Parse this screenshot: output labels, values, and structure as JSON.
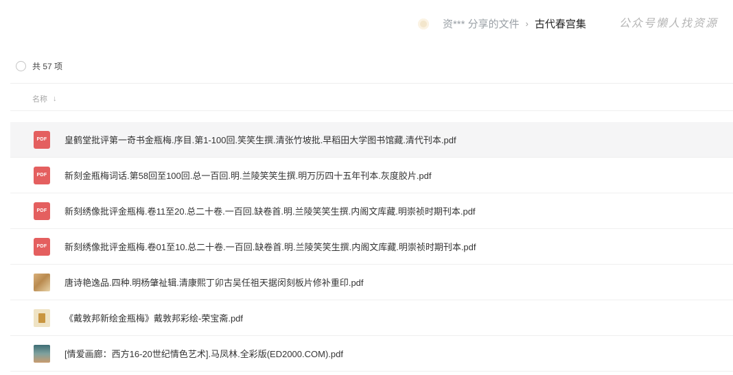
{
  "breadcrumb": {
    "owner": "资*** 分享的文件",
    "separator": "›",
    "current": "古代春宫集"
  },
  "watermark": "公众号懒人找资源",
  "summary": {
    "count_text": "共 57 项"
  },
  "sort_header": {
    "label": "名称",
    "arrow": "↓"
  },
  "files": [
    {
      "name": "皇鹤堂批评第一奇书金瓶梅.序目.第1-100回.笑笑生撰.清张竹坡批.早稻田大学图书馆藏.清代刊本.pdf",
      "icon": "pdf-file-icon",
      "icon_label": "PDF"
    },
    {
      "name": "新刻金瓶梅词话.第58回至100回.总一百回.明.兰陵笑笑生撰.明万历四十五年刊本.灰度胶片.pdf",
      "icon": "pdf-file-icon",
      "icon_label": "PDF"
    },
    {
      "name": "新刻绣像批评金瓶梅.卷11至20.总二十卷.一百回.缺卷首.明.兰陵笑笑生撰.内阁文库藏.明崇祯时期刊本.pdf",
      "icon": "pdf-file-icon",
      "icon_label": "PDF"
    },
    {
      "name": "新刻绣像批评金瓶梅.卷01至10.总二十卷.一百回.缺卷首.明.兰陵笑笑生撰.内阁文库藏.明崇祯时期刊本.pdf",
      "icon": "pdf-file-icon",
      "icon_label": "PDF"
    },
    {
      "name": "唐诗艳逸品.四种.明杨肇祉辑.清康熙丁卯古吴任祖天据闵刻板片修补重印.pdf",
      "icon": "thumbnail-icon",
      "icon_label": ""
    },
    {
      "name": "《戴敦邦新绘金瓶梅》戴敦邦彩绘-荣宝斋.pdf",
      "icon": "thumbnail-icon",
      "icon_label": ""
    },
    {
      "name": "[情爱画廊：西方16-20世纪情色艺术].马凤林.全彩版(ED2000.COM).pdf",
      "icon": "thumbnail-icon",
      "icon_label": ""
    }
  ]
}
